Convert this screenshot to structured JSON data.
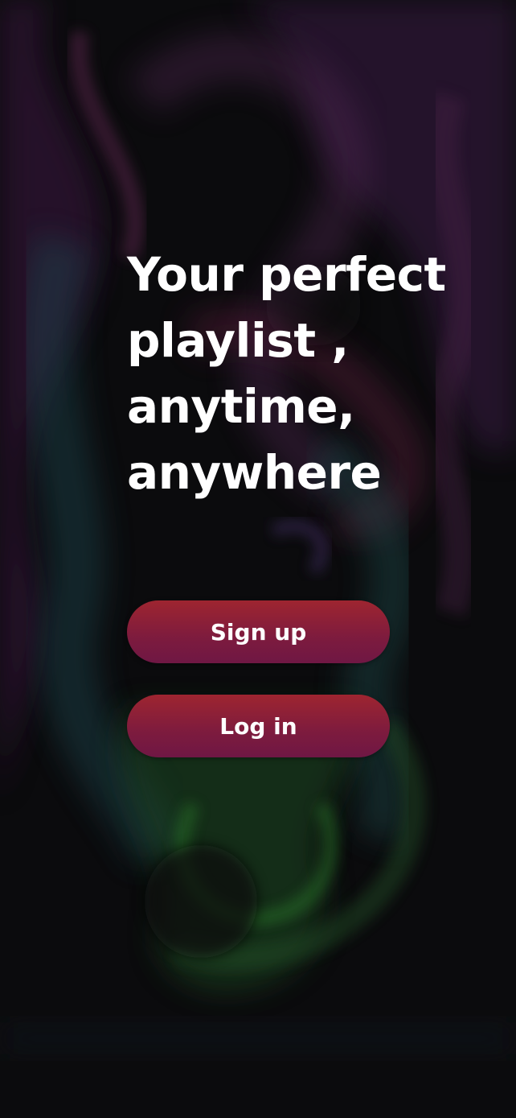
{
  "welcome": {
    "headline_lines": [
      "Your perfect",
      "playlist ,",
      "anytime,",
      "anywhere"
    ]
  },
  "actions": {
    "signup_label": "Sign up",
    "login_label": "Log in"
  },
  "colors": {
    "button_top": "#9e2530",
    "button_bottom": "#6f1744",
    "text": "#ffffff",
    "background": "#0b0b0d"
  }
}
